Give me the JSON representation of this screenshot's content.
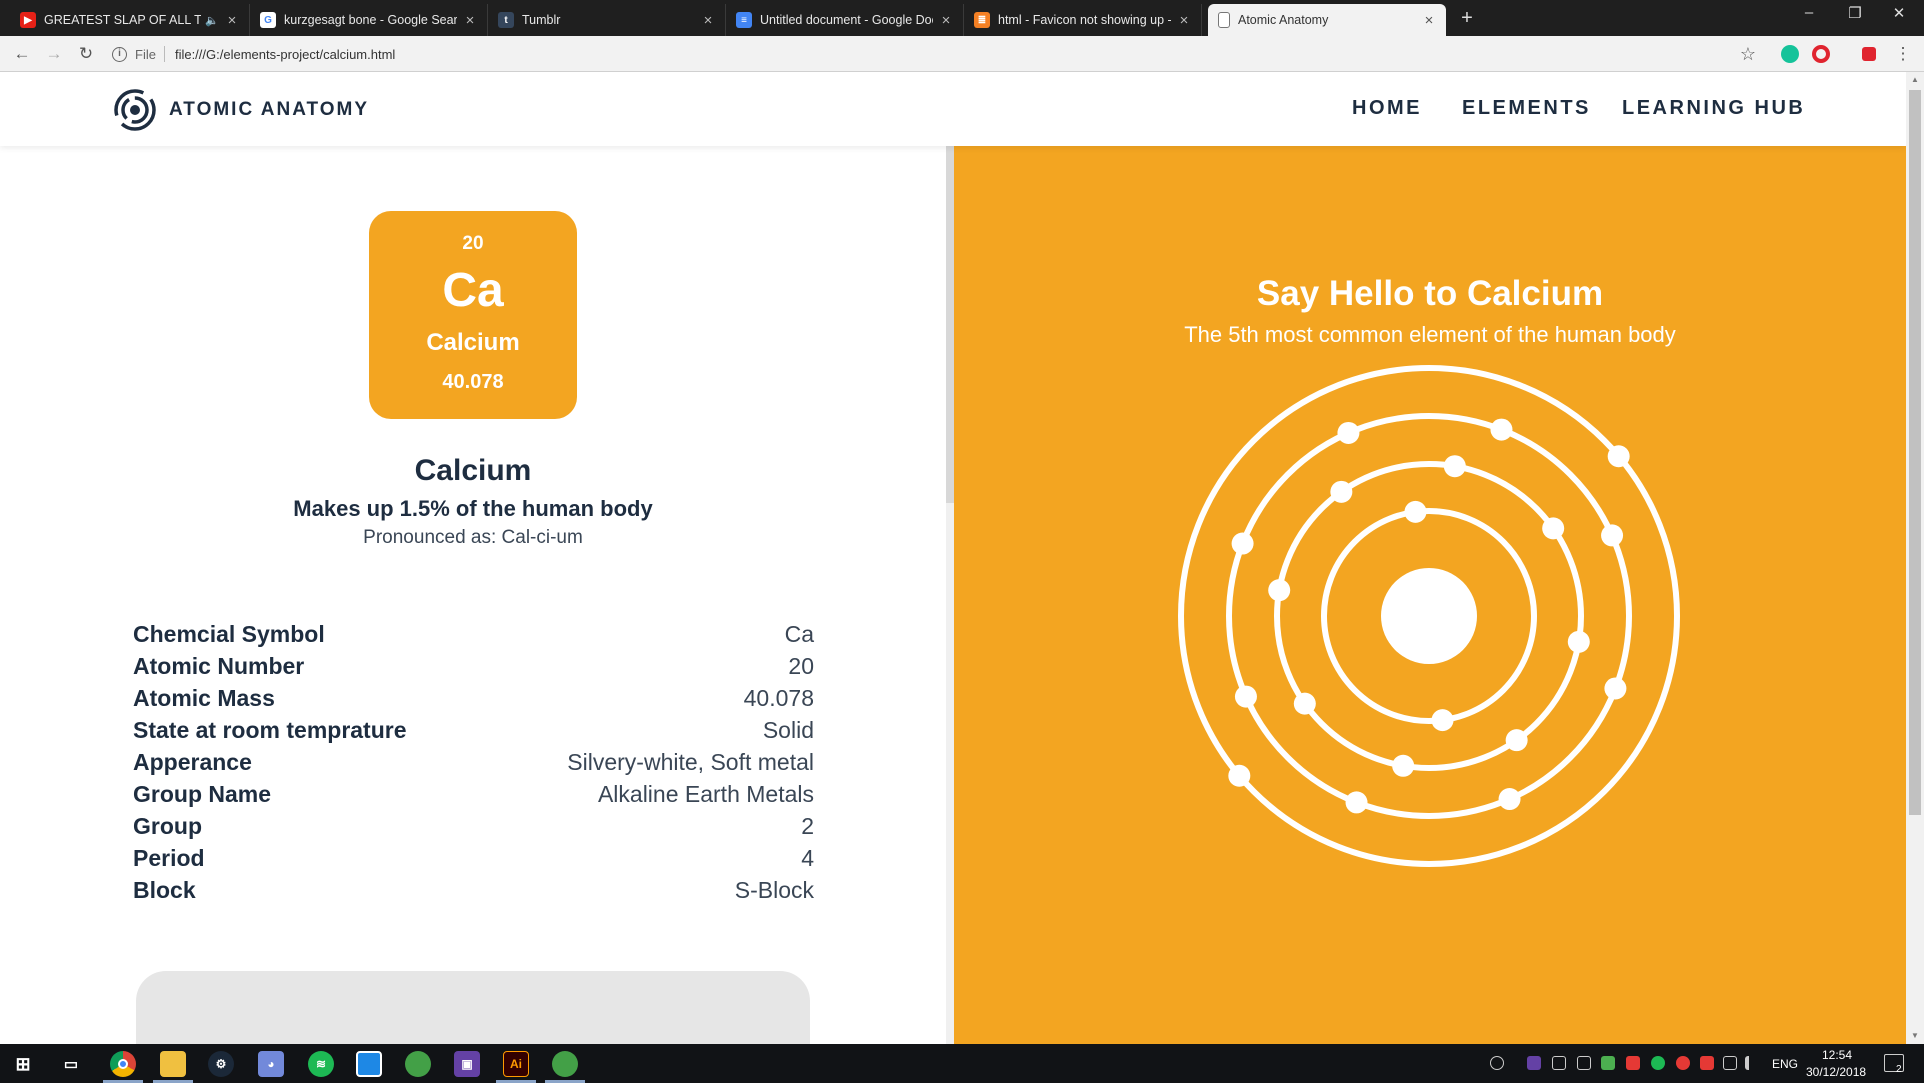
{
  "browser": {
    "tabs": [
      {
        "title": "GREATEST SLAP OF ALL TIME",
        "favicon": "youtube-icon",
        "muted": true
      },
      {
        "title": "kurzgesagt bone - Google Search",
        "favicon": "google-icon"
      },
      {
        "title": "Tumblr",
        "favicon": "tumblr-icon"
      },
      {
        "title": "Untitled document - Google Docs",
        "favicon": "google-docs-icon"
      },
      {
        "title": "html - Favicon not showing up - ",
        "favicon": "stackoverflow-icon"
      },
      {
        "title": "Atomic Anatomy",
        "favicon": "document-icon",
        "active": true
      }
    ],
    "address": {
      "scheme": "File",
      "url": "file:///G:/elements-project/calcium.html"
    }
  },
  "site": {
    "logo_text": "ATOMIC ANATOMY",
    "nav": [
      "HOME",
      "ELEMENTS",
      "LEARNING HUB"
    ]
  },
  "element": {
    "tile": {
      "number": "20",
      "symbol": "Ca",
      "name": "Calcium",
      "mass": "40.078"
    },
    "name": "Calcium",
    "subtitle": "Makes up 1.5% of the human body",
    "pronounced": "Pronounced as: Cal-ci-um",
    "properties": [
      {
        "label": "Chemcial Symbol",
        "value": "Ca"
      },
      {
        "label": "Atomic Number",
        "value": "20"
      },
      {
        "label": "Atomic Mass",
        "value": "40.078"
      },
      {
        "label": "State at room temprature",
        "value": "Solid"
      },
      {
        "label": "Apperance",
        "value": "Silvery-white, Soft metal"
      },
      {
        "label": "Group Name",
        "value": "Alkaline Earth Metals"
      },
      {
        "label": "Group",
        "value": "2"
      },
      {
        "label": "Period",
        "value": "4"
      },
      {
        "label": "Block",
        "value": "S-Block"
      }
    ]
  },
  "hero": {
    "title": "Say Hello to Calcium",
    "subtitle": "The 5th most common element of the human body",
    "atom": {
      "shells": [
        2,
        8,
        8,
        2
      ],
      "color": "#f3a521"
    }
  },
  "taskbar": {
    "apps": [
      "windows-start-icon",
      "task-view-icon",
      "chrome-icon",
      "file-explorer-icon",
      "steam-icon",
      "discord-icon",
      "spotify-icon",
      "app-icon",
      "globe-icon",
      "twitch-icon",
      "illustrator-icon",
      "globe-icon"
    ],
    "illustrator_label": "Ai",
    "language": "ENG",
    "time": "12:54",
    "date": "30/12/2018",
    "notifications": "2"
  },
  "colors": {
    "accent": "#f3a521",
    "heading": "#1e2d40",
    "text": "#3a4655"
  }
}
